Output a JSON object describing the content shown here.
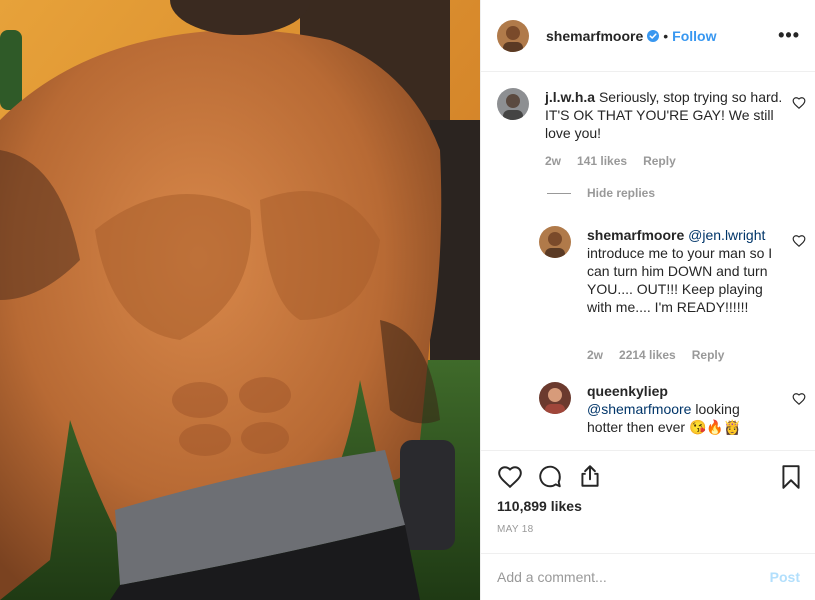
{
  "post": {
    "photo_alt": "shirtless selfie"
  },
  "header": {
    "username": "shemarfmoore",
    "separator": "•",
    "follow_label": "Follow",
    "more_label": "•••"
  },
  "comments": [
    {
      "username": "j.l.w.h.a",
      "text": "Seriously, stop trying so hard. IT'S OK THAT YOU'RE GAY! We still love you!",
      "time": "2w",
      "likes": "141 likes",
      "reply_label": "Reply"
    },
    {
      "username": "shemarfmoore",
      "mention": "@jen.lwright",
      "text": "introduce me to your man so I can turn him DOWN and turn YOU.... OUT!!! Keep playing with me.... I'm READY!!!!!!",
      "time": "2w",
      "likes": "2214 likes",
      "reply_label": "Reply"
    },
    {
      "username": "queenkyliep",
      "mention": "@shemarfmoore",
      "text": "looking hotter then ever",
      "emoji": "😘🔥👸"
    }
  ],
  "hide_replies_label": "Hide replies",
  "actions": {
    "likes_count": "110,899 likes",
    "date": "MAY 18"
  },
  "add_comment": {
    "placeholder": "Add a comment...",
    "post_label": "Post"
  },
  "colors": {
    "accent": "#3897f0",
    "muted": "#999999",
    "text": "#262626",
    "post_disabled": "#b2dffc"
  }
}
